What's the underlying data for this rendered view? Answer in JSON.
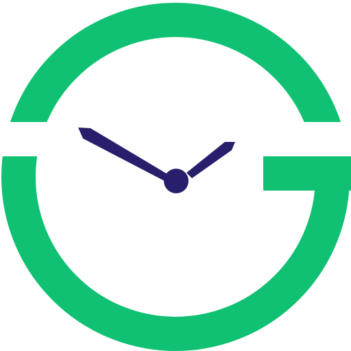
{
  "logo": {
    "icon": "clock-g-logo-icon",
    "colors": {
      "ring": "#10C173",
      "hands": "#271F6B",
      "background": "#FFFFFF"
    }
  }
}
